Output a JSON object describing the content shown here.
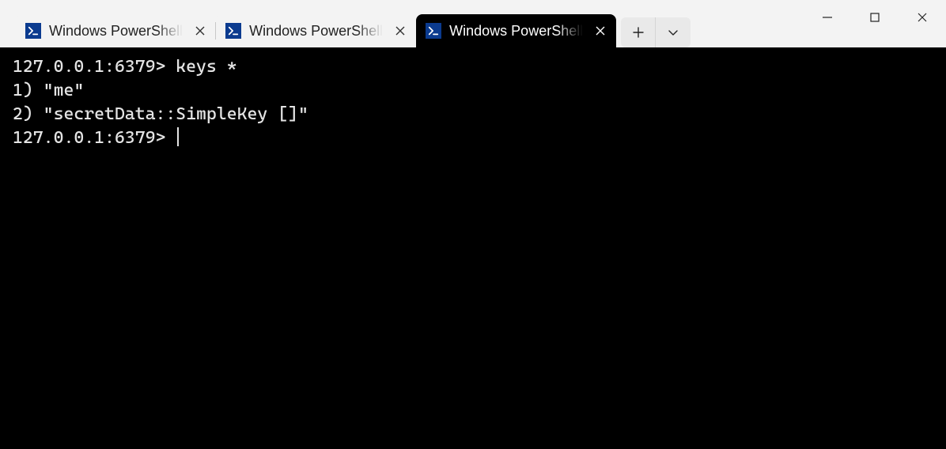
{
  "colors": {
    "titlebar": "#f3f3f3",
    "terminal_bg": "#000000",
    "terminal_fg": "#e4e4e4",
    "ps_icon_bg": "#0b3b8f"
  },
  "tabs": {
    "items": [
      {
        "title": "Windows PowerShell",
        "icon": "powershell-icon",
        "active": false
      },
      {
        "title": "Windows PowerShell",
        "icon": "powershell-icon",
        "active": false
      },
      {
        "title": "Windows PowerShell",
        "icon": "powershell-icon",
        "active": true
      }
    ]
  },
  "terminal": {
    "lines": [
      {
        "prompt": "127.0.0.1:6379> ",
        "command": "keys *"
      },
      {
        "output": "1) \"me\""
      },
      {
        "output": "2) \"secretData::SimpleKey []\""
      },
      {
        "prompt": "127.0.0.1:6379> ",
        "command": "",
        "cursor": true
      }
    ],
    "prompt_host": "127.0.0.1:6379>"
  },
  "redis": {
    "host": "127.0.0.1",
    "port": "6379",
    "command": "keys *",
    "keys": [
      "me",
      "secretData::SimpleKey []"
    ]
  }
}
